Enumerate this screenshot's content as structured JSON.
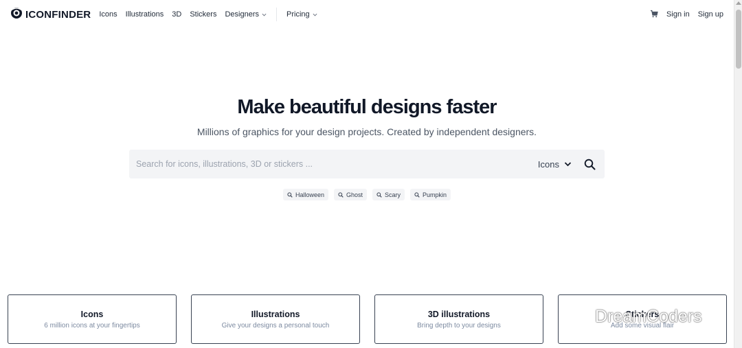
{
  "nav": {
    "brand": "ICONFINDER",
    "links": [
      "Icons",
      "Illustrations",
      "3D",
      "Stickers",
      "Designers"
    ],
    "pricing": "Pricing",
    "sign_in": "Sign in",
    "sign_up": "Sign up"
  },
  "hero": {
    "title_pre": "Make",
    "title_highlight": "beautiful designs",
    "title_post": "faster",
    "subtitle": "Millions of graphics for your design projects. Created by independent designers."
  },
  "search": {
    "placeholder": "Search for icons, illustrations, 3D or stickers ...",
    "value": "",
    "type": "Icons"
  },
  "tags": [
    "Halloween",
    "Ghost",
    "Scary",
    "Pumpkin"
  ],
  "cards": [
    {
      "title": "Icons",
      "desc": "6 million icons at your fingertips"
    },
    {
      "title": "Illustrations",
      "desc": "Give your designs a personal touch"
    },
    {
      "title": "3D illustrations",
      "desc": "Bring depth to your designs"
    },
    {
      "title": "Stickers",
      "desc": "Add some visual flair"
    }
  ],
  "watermark": "DreamCoders",
  "icons": {
    "logo": "iconfinder-eye-logo-icon",
    "cart": "cart-icon",
    "chevron": "chevron-down-icon",
    "search": "search-icon",
    "tag_search": "search-icon",
    "watermark": "wechat-icon"
  },
  "colors": {
    "highlight": "#fde6b8",
    "search_bg": "#f3f4f6",
    "card_desc": "#7c8aa0",
    "text": "#111827"
  }
}
